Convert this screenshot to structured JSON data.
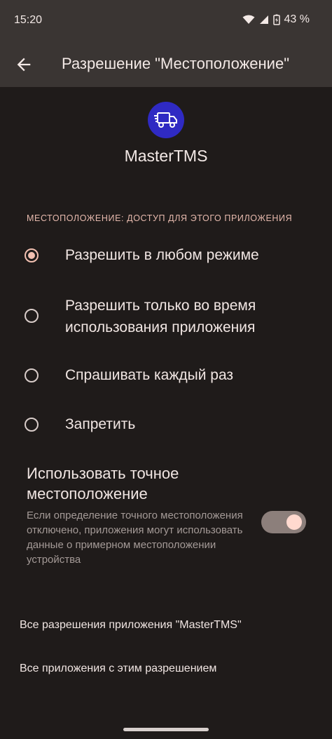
{
  "status_bar": {
    "time": "15:20",
    "battery": "43 %",
    "icons": [
      "wifi-icon",
      "signal-icon",
      "battery-charging-icon"
    ]
  },
  "app_bar": {
    "title": "Разрешение \"Местоположение\"",
    "back_icon": "arrow-back-icon"
  },
  "app": {
    "name": "MasterTMS",
    "icon": "truck-icon",
    "icon_color": "#2f2ac3"
  },
  "location_section": {
    "label": "МЕСТОПОЛОЖЕНИЕ: ДОСТУП ДЛЯ ЭТОГО ПРИЛОЖЕНИЯ",
    "options": [
      {
        "label": "Разрешить в любом режиме",
        "selected": true
      },
      {
        "label": "Разрешить только во время использования приложения",
        "selected": false
      },
      {
        "label": "Спрашивать каждый раз",
        "selected": false
      },
      {
        "label": "Запретить",
        "selected": false
      }
    ]
  },
  "precise_location": {
    "title": "Использовать точное местоположение",
    "description": "Если определение точного местоположения отключено, приложения могут использовать данные о примерном местоположении устройства",
    "enabled": true
  },
  "links": {
    "all_app_permissions": "Все разрешения приложения \"MasterTMS\"",
    "all_apps_with_permission": "Все приложения с этим разрешением"
  },
  "colors": {
    "accent": "#f2c0b1",
    "background": "#1f1b1a",
    "bar": "#3a3533"
  }
}
